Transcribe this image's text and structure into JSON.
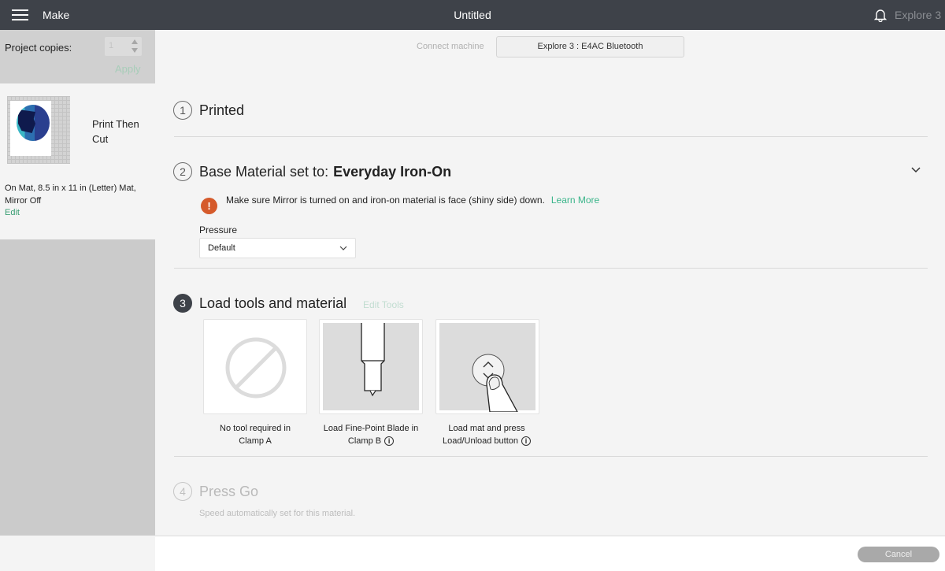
{
  "topbar": {
    "menu_icon": "hamburger-icon",
    "app_title": "Make",
    "document_title": "Untitled",
    "notification_icon": "bell-icon",
    "machine_name": "Explore 3"
  },
  "sidebar": {
    "project_copies_label": "Project copies:",
    "project_copies_value": "1",
    "apply_label": "Apply",
    "mat": {
      "title": "Print Then Cut",
      "info": "On Mat, 8.5 in x 11 in (Letter) Mat, Mirror Off",
      "edit_label": "Edit"
    }
  },
  "connect": {
    "label": "Connect machine",
    "device_button": "Explore 3 : E4AC Bluetooth"
  },
  "steps": [
    {
      "number": "1",
      "title": "Printed",
      "state": "done"
    },
    {
      "number": "2",
      "title": "Base Material set to:",
      "material": "Everyday Iron-On",
      "state": "done",
      "warning": {
        "icon": "exclamation-icon",
        "text": "Make sure Mirror is turned on and iron-on material is face (shiny side) down.",
        "link": "Learn More"
      },
      "pressure_label": "Pressure",
      "pressure_value": "Default"
    },
    {
      "number": "3",
      "title": "Load tools and material",
      "state": "active",
      "edit_tools_label": "Edit Tools",
      "tools": [
        {
          "icon": "no-tool-icon",
          "caption_line1": "No tool required in",
          "caption_line2": "Clamp A",
          "has_info": false
        },
        {
          "icon": "fine-point-blade-icon",
          "caption_line1": "Load Fine-Point Blade in",
          "caption_line2": "Clamp B",
          "has_info": true
        },
        {
          "icon": "load-unload-button-icon",
          "caption_line1": "Load mat and press",
          "caption_line2": "Load/Unload button",
          "has_info": true
        }
      ]
    },
    {
      "number": "4",
      "title": "Press Go",
      "state": "disabled",
      "note": "Speed automatically set for this material."
    }
  ],
  "footer": {
    "cancel_label": "Cancel"
  },
  "colors": {
    "topbar_bg": "#3e4249",
    "accent_green": "#3ab58a",
    "warning_orange": "#d55a2b"
  }
}
